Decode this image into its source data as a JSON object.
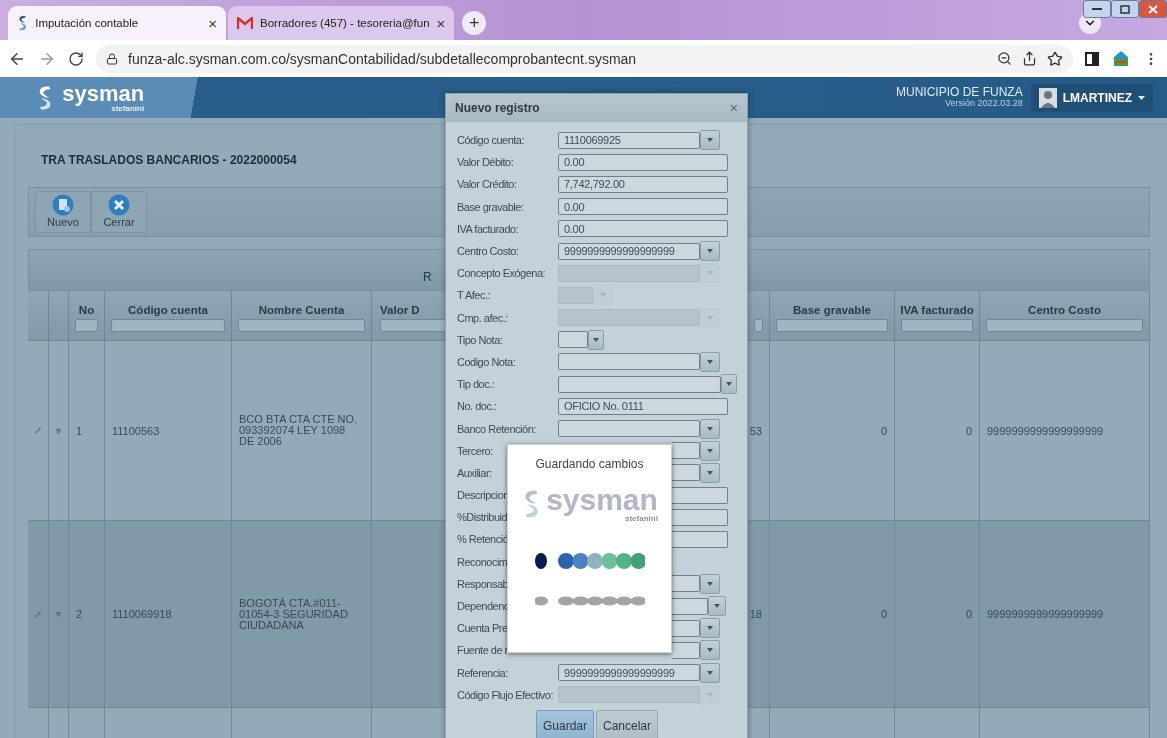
{
  "browser": {
    "tabs": [
      {
        "title": "Imputación contable",
        "selected": true,
        "close": "×"
      },
      {
        "title": "Borradores (457) - tesoreria@fun",
        "selected": false,
        "close": "×"
      }
    ],
    "new_tab": "+",
    "url": "funza-alc.sysman.com.co/sysmanContabilidad/subdetallecomprobantecnt.sysman"
  },
  "header": {
    "logo": "sysman",
    "logo_sub": "stefanini",
    "entity": "MUNICIPIO DE FUNZA",
    "version": "Versión 2022.03.28",
    "user": "LMARTINEZ"
  },
  "page": {
    "title": "TRA TRASLADOS BANCARIOS - 2022000054",
    "toolbar": [
      {
        "label": "Nuevo",
        "kind": "new"
      },
      {
        "label": "Cerrar",
        "kind": "close"
      }
    ],
    "table": {
      "group_header": "R",
      "columns": [
        "No",
        "Código cuenta",
        "Nombre Cuenta",
        "Valor D",
        "Base gravable",
        "IVA facturado",
        "Centro Costo"
      ],
      "rows": [
        {
          "no": "1",
          "account": "11100563",
          "name": "BCO BTA CTA CTE NO. 093392074 LEY 1098 DE 2006",
          "column_6": "53",
          "base": "0",
          "iva": "0",
          "cost_center": "9999999999999999999",
          "hovered": false
        },
        {
          "no": "2",
          "account": "1110069918",
          "name": "BOGOTÁ CTA.#011-01054-3 SEGURIDAD CIUDADANA",
          "column_6": "18",
          "base": "0",
          "iva": "0",
          "cost_center": "9999999999999999999",
          "hovered": true
        }
      ]
    }
  },
  "dialog": {
    "title": "Nuevo registro",
    "close": "×",
    "fields": [
      {
        "label": "Código cuenta:",
        "kind": "select",
        "value": "1110069925",
        "disabled": false
      },
      {
        "label": "Valor Débito:",
        "kind": "text",
        "value": "0.00",
        "disabled": false
      },
      {
        "label": "Valor Crédito:",
        "kind": "text",
        "value": "7,742,792.00",
        "disabled": false
      },
      {
        "label": "Base gravable:",
        "kind": "text",
        "value": "0.00",
        "disabled": false
      },
      {
        "label": "IVA facturado:",
        "kind": "text",
        "value": "0.00",
        "disabled": false
      },
      {
        "label": "Centro Costo:",
        "kind": "select",
        "value": "9999999999999999999",
        "disabled": false
      },
      {
        "label": "Concepto Exógena:",
        "kind": "select",
        "disabled": true
      },
      {
        "label": "T Afec.:",
        "kind": "select_small",
        "disabled": true
      },
      {
        "label": "Cmp. afec.:",
        "kind": "select",
        "disabled": true
      },
      {
        "label": "Tipo Nota:",
        "kind": "select_tiny",
        "disabled": false
      },
      {
        "label": "Codigo Nota:",
        "kind": "select",
        "disabled": false
      },
      {
        "label": "Tip doc.:",
        "kind": "select_wide",
        "disabled": false
      },
      {
        "label": "No. doc.:",
        "kind": "text",
        "value": "OFICIO No. 0111",
        "disabled": false
      },
      {
        "label": "Banco Retención:",
        "kind": "select",
        "disabled": false
      },
      {
        "label": "Tercero:",
        "kind": "select",
        "disabled": false
      },
      {
        "label": "Auxiliar:",
        "kind": "select",
        "disabled": false
      },
      {
        "label": "Descripcion",
        "kind": "text",
        "disabled": false
      },
      {
        "label": "%Distribuid",
        "kind": "text",
        "disabled": false
      },
      {
        "label": "% Retenció",
        "kind": "text",
        "disabled": false
      },
      {
        "label": "Reconocim",
        "kind": "none",
        "disabled": false
      },
      {
        "label": "Responsab",
        "kind": "select",
        "disabled": false
      },
      {
        "label": "Dependenc",
        "kind": "select_mid",
        "disabled": false
      },
      {
        "label": "Cuenta Pre",
        "kind": "select",
        "disabled": false
      },
      {
        "label": "Fuente de r",
        "kind": "select",
        "disabled": false
      },
      {
        "label": "Referencia:",
        "kind": "select",
        "value": "9999999999999999999",
        "disabled": false
      },
      {
        "label": "Código Flujo Efectivo:",
        "kind": "select",
        "disabled": true
      }
    ],
    "buttons": [
      {
        "label": "Guardar",
        "focused": true
      },
      {
        "label": "Cancelar",
        "focused": false
      }
    ]
  },
  "loading": {
    "title": "Guardando cambios",
    "logo": "sysman",
    "logo_sub": "stefanini"
  }
}
